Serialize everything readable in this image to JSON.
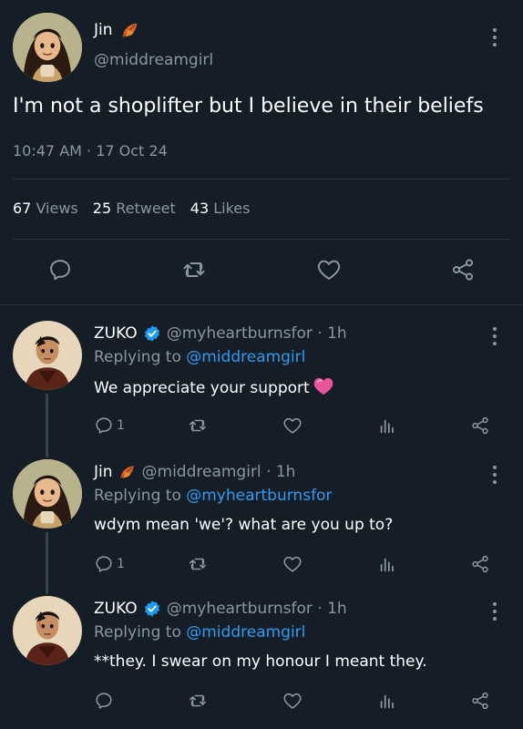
{
  "main_tweet": {
    "display_name": "Jin",
    "handle": "@middreamgirl",
    "text": "I'm not a shoplifter but I believe in their beliefs",
    "timestamp": "10:47 AM · 17 Oct 24",
    "stats": {
      "views_count": "67",
      "views_label": "Views",
      "retweet_count": "25",
      "retweet_label": "Retweet",
      "likes_count": "43",
      "likes_label": "Likes"
    }
  },
  "replies": [
    {
      "display_name": "ZUKO",
      "handle_time": "@myheartburnsfor · 1h",
      "replying_prefix": "Replying to",
      "replying_to": "@middreamgirl",
      "text": "We appreciate your support",
      "reply_count": "1",
      "verified": true
    },
    {
      "display_name": "Jin",
      "handle_time": "@middreamgirl · 1h",
      "replying_prefix": "Replying to",
      "replying_to": "@myheartburnsfor",
      "text": "wdym mean 'we'? what are you up to?",
      "reply_count": "1",
      "verified": false
    },
    {
      "display_name": "ZUKO",
      "handle_time": "@myheartburnsfor · 1h",
      "replying_prefix": "Replying to",
      "replying_to": "@middreamgirl",
      "text": "**they. I swear on my honour I meant they.",
      "reply_count": "",
      "verified": true
    }
  ],
  "colors": {
    "background": "#151d27",
    "accent_link": "#2f9bf0",
    "muted_text": "#8a96a3",
    "verified_badge": "#1d9bf0",
    "heart_emoji": "#e8559a"
  },
  "icons": [
    "kebab-menu-icon",
    "reply-icon",
    "retweet-icon",
    "like-icon",
    "share-icon",
    "analytics-icon",
    "verified-badge-icon",
    "leaf-emoji-icon",
    "pink-heart-emoji-icon"
  ]
}
